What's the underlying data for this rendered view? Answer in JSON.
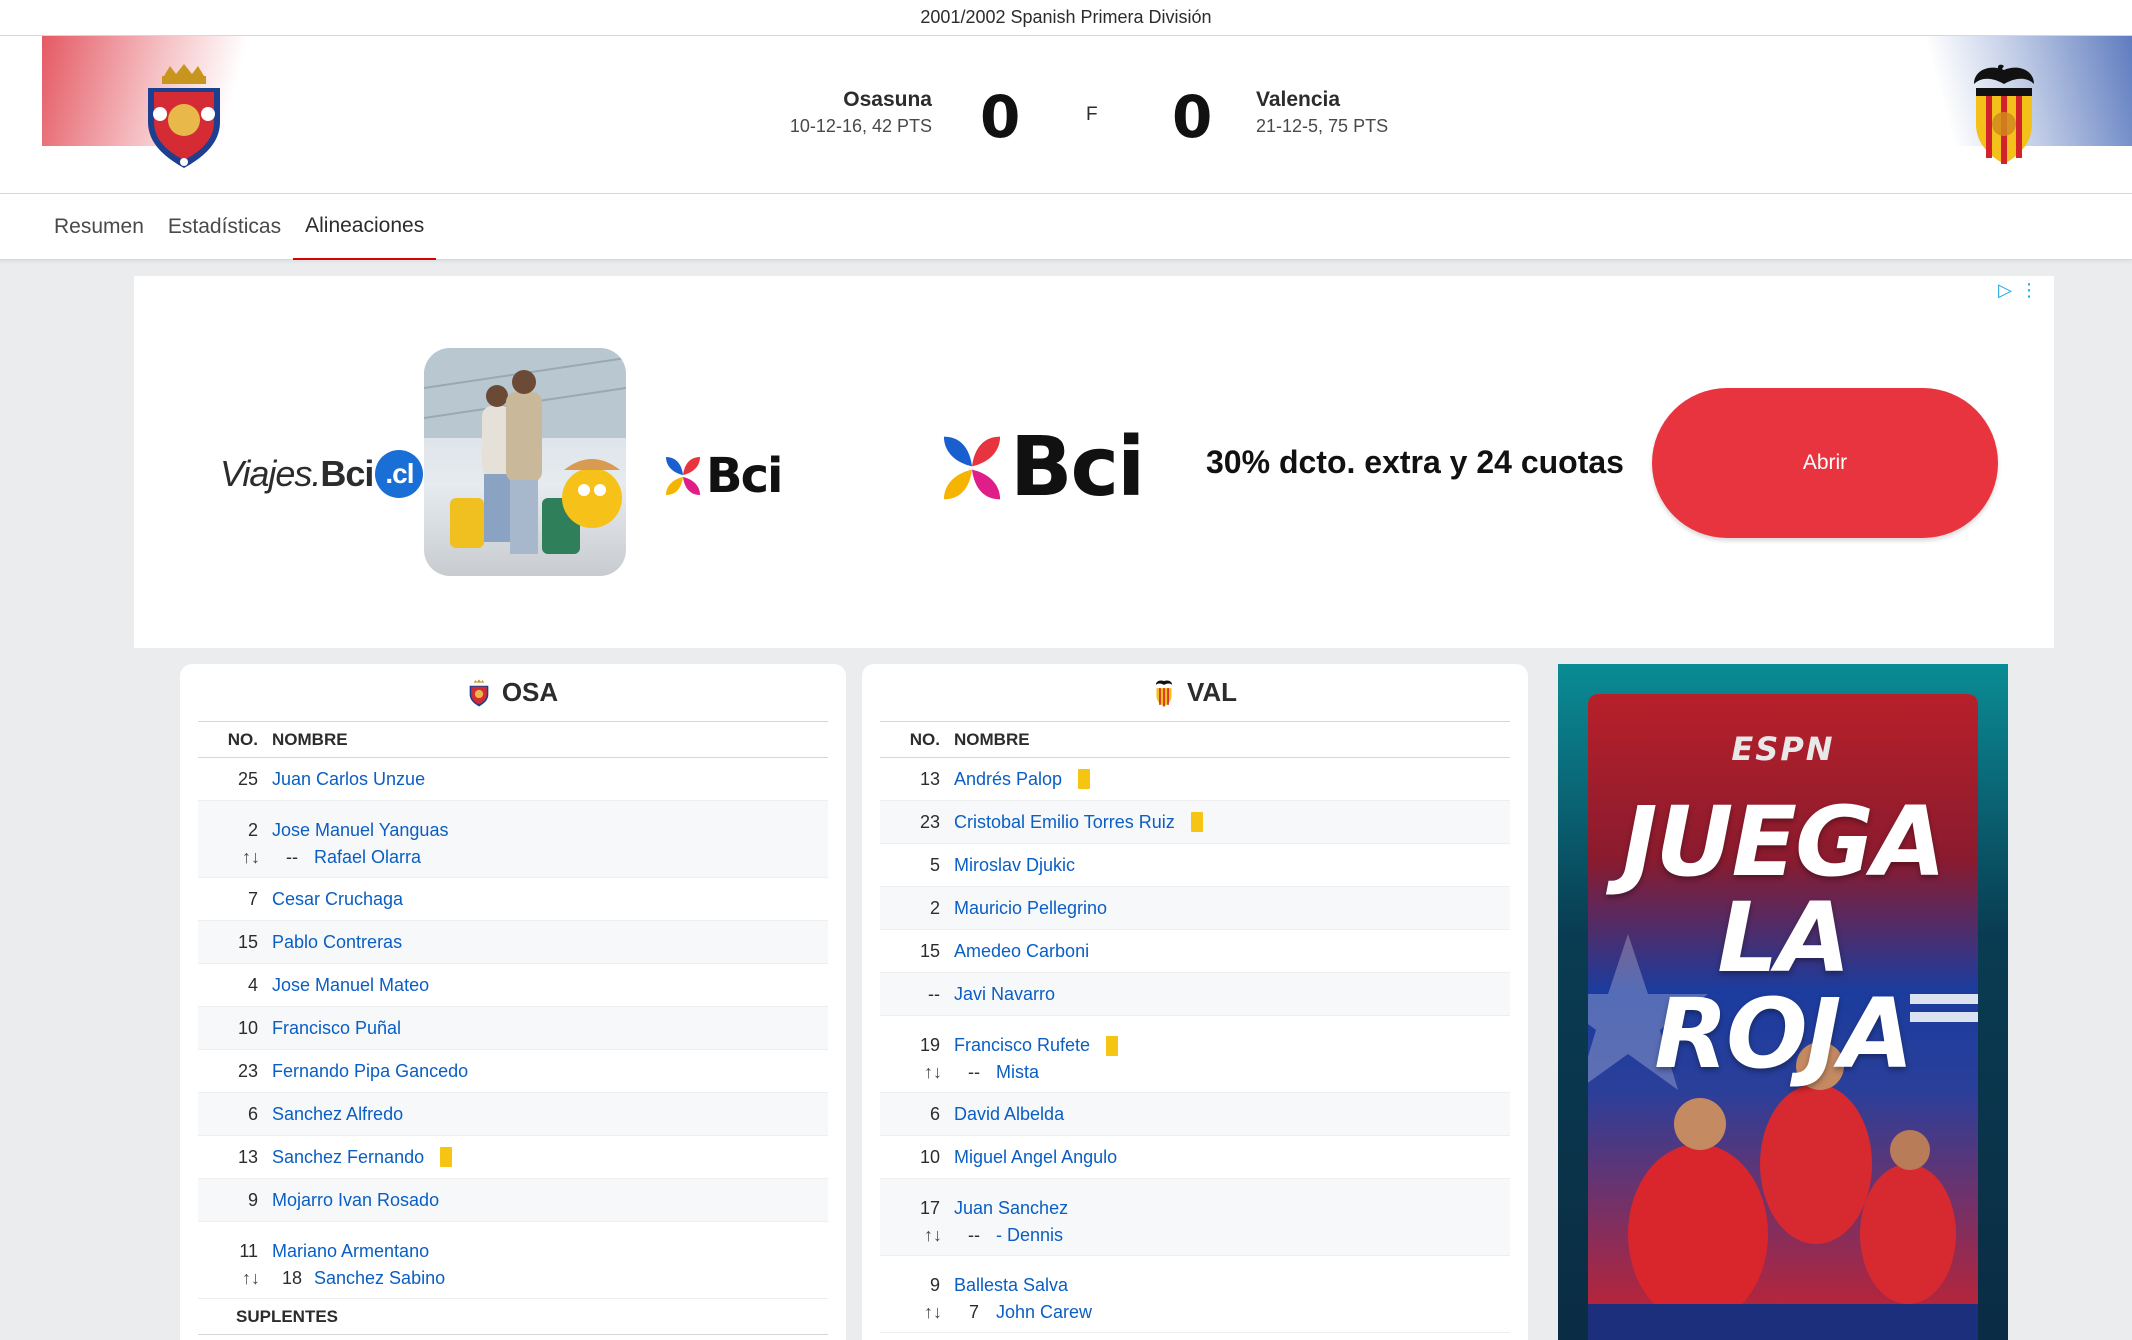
{
  "league": "2001/2002 Spanish Primera División",
  "match": {
    "home": {
      "name": "Osasuna",
      "record": "10-12-16, 42 PTS",
      "score": "0",
      "abbr": "OSA",
      "color": "#d02030"
    },
    "away": {
      "name": "Valencia",
      "record": "21-12-5, 75 PTS",
      "score": "0",
      "abbr": "VAL",
      "color": "#f5a623"
    },
    "status": "F"
  },
  "tabs": [
    {
      "label": "Resumen",
      "active": false
    },
    {
      "label": "Estadísticas",
      "active": false
    },
    {
      "label": "Alineaciones",
      "active": true
    }
  ],
  "ad": {
    "brand_prefix": "Viajes.",
    "brand_bold": "Bci",
    "brand_suffix": ".cl",
    "logo_word": "Bci",
    "headline": "30% dcto. extra y 24 cuotas",
    "cta": "Abrir"
  },
  "lineups": {
    "col_no": "NO.",
    "col_name": "NOMBRE",
    "subs_label": "SUPLENTES",
    "home": [
      {
        "no": "25",
        "name": "Juan Carlos Unzue",
        "yellow": false
      },
      {
        "no": "2",
        "name": "Jose Manuel Yanguas",
        "yellow": false,
        "sub": {
          "no": "--",
          "name": "Rafael Olarra"
        }
      },
      {
        "no": "7",
        "name": "Cesar Cruchaga",
        "yellow": false
      },
      {
        "no": "15",
        "name": "Pablo Contreras",
        "yellow": false
      },
      {
        "no": "4",
        "name": "Jose Manuel Mateo",
        "yellow": false
      },
      {
        "no": "10",
        "name": "Francisco Puñal",
        "yellow": false
      },
      {
        "no": "23",
        "name": "Fernando Pipa Gancedo",
        "yellow": false
      },
      {
        "no": "6",
        "name": "Sanchez Alfredo",
        "yellow": false
      },
      {
        "no": "13",
        "name": "Sanchez Fernando",
        "yellow": true
      },
      {
        "no": "9",
        "name": "Mojarro Ivan Rosado",
        "yellow": false
      },
      {
        "no": "11",
        "name": "Mariano Armentano",
        "yellow": false,
        "sub": {
          "no": "18",
          "name": "Sanchez Sabino"
        }
      }
    ],
    "away": [
      {
        "no": "13",
        "name": "Andrés Palop",
        "yellow": true
      },
      {
        "no": "23",
        "name": "Cristobal Emilio Torres Ruiz",
        "yellow": true
      },
      {
        "no": "5",
        "name": "Miroslav Djukic",
        "yellow": false
      },
      {
        "no": "2",
        "name": "Mauricio Pellegrino",
        "yellow": false
      },
      {
        "no": "15",
        "name": "Amedeo Carboni",
        "yellow": false
      },
      {
        "no": "--",
        "name": "Javi Navarro",
        "yellow": false
      },
      {
        "no": "19",
        "name": "Francisco Rufete",
        "yellow": true,
        "sub": {
          "no": "--",
          "name": "Mista"
        }
      },
      {
        "no": "6",
        "name": "David Albelda",
        "yellow": false
      },
      {
        "no": "10",
        "name": "Miguel Angel Angulo",
        "yellow": false
      },
      {
        "no": "17",
        "name": "Juan Sanchez",
        "yellow": false,
        "sub": {
          "no": "--",
          "name": "- Dennis"
        }
      },
      {
        "no": "9",
        "name": "Ballesta Salva",
        "yellow": false,
        "sub": {
          "no": "7",
          "name": "John Carew"
        }
      }
    ]
  },
  "side_ad": {
    "brand": "ESPN",
    "line1": "JUEGA",
    "line2": "LA ROJA"
  },
  "icons": {
    "sub_arrows": "↑↓"
  }
}
